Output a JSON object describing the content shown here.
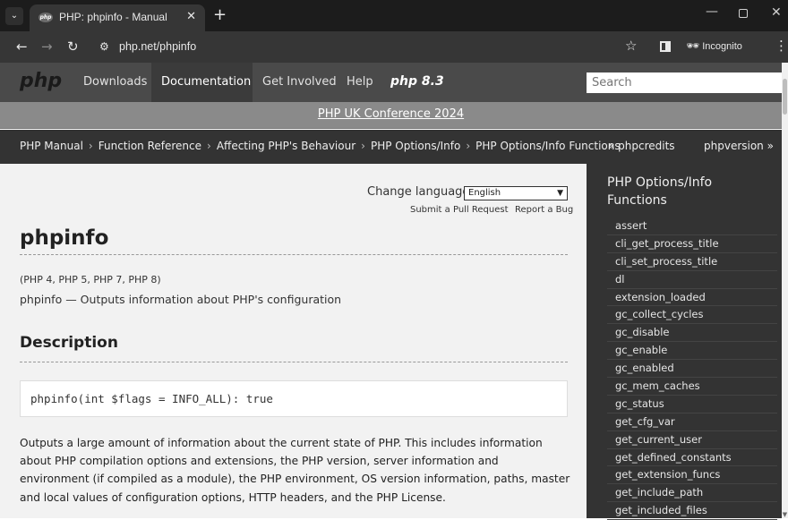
{
  "browser": {
    "tab_title": "PHP: phpinfo - Manual",
    "favicon_text": "php",
    "url": "php.net/phpinfo",
    "incognito_label": "Incognito"
  },
  "nav": {
    "logo": "php",
    "links": [
      "Downloads",
      "Documentation",
      "Get Involved",
      "Help"
    ],
    "version_badge": "php 8.3",
    "search_placeholder": "Search"
  },
  "banner": {
    "text": "PHP UK Conference 2024"
  },
  "breadcrumbs": {
    "items": [
      "PHP Manual",
      "Function Reference",
      "Affecting PHP's Behaviour",
      "PHP Options/Info",
      "PHP Options/Info Functions"
    ],
    "prev": "« phpcredits",
    "next": "phpversion »"
  },
  "main": {
    "change_language_label": "Change language:",
    "language_selected": "English",
    "pull_request_link": "Submit a Pull Request",
    "report_bug_link": "Report a Bug",
    "title": "phpinfo",
    "versions": "(PHP 4, PHP 5, PHP 7, PHP 8)",
    "refname": "phpinfo — Outputs information about PHP's configuration",
    "description_heading": "Description",
    "synopsis": "phpinfo(int $flags = INFO_ALL): true",
    "paragraph": "Outputs a large amount of information about the current state of PHP. This includes information about PHP compilation options and extensions, the PHP version, server information and environment (if compiled as a module), the PHP environment, OS version information, paths, master and local values of configuration options, HTTP headers, and the PHP License."
  },
  "sidebar": {
    "title": "PHP Options/Info Functions",
    "items": [
      "assert",
      "cli_get_process_title",
      "cli_set_process_title",
      "dl",
      "extension_loaded",
      "gc_collect_cycles",
      "gc_disable",
      "gc_enable",
      "gc_enabled",
      "gc_mem_caches",
      "gc_status",
      "get_cfg_var",
      "get_current_user",
      "get_defined_constants",
      "get_extension_funcs",
      "get_include_path",
      "get_included_files"
    ]
  }
}
